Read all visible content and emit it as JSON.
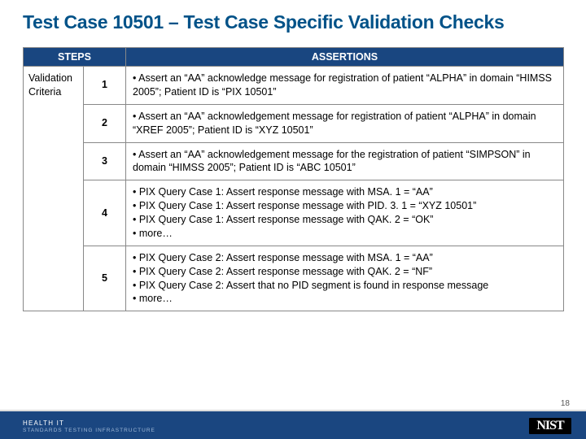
{
  "title": "Test Case 10501 – Test Case Specific Validation Checks",
  "table": {
    "headers": {
      "steps": "STEPS",
      "assertions": "ASSERTIONS"
    },
    "row_label": "Validation Criteria",
    "rows": [
      {
        "step": "1",
        "assertion": "• Assert an “AA” acknowledge message for registration of patient “ALPHA” in domain “HIMSS 2005”; Patient ID is “PIX 10501”"
      },
      {
        "step": "2",
        "assertion": "• Assert an “AA” acknowledgement message for registration of patient “ALPHA” in domain “XREF 2005”; Patient ID is “XYZ 10501”"
      },
      {
        "step": "3",
        "assertion": "• Assert an “AA” acknowledgement message for the registration of patient “SIMPSON” in domain “HIMSS 2005”; Patient ID is “ABC 10501”"
      },
      {
        "step": "4",
        "assertion": "• PIX Query Case 1: Assert response message with MSA. 1 = “AA”\n• PIX Query Case 1: Assert response message with PID. 3. 1 = “XYZ 10501”\n• PIX Query Case 1: Assert response message with QAK. 2 = “OK”\n• more…"
      },
      {
        "step": "5",
        "assertion": "• PIX Query Case 2: Assert response message with MSA. 1 = “AA”\n• PIX Query Case 2: Assert response message with QAK. 2 = “NF”\n• PIX Query Case 2: Assert that no PID segment is found in response message\n• more…"
      }
    ]
  },
  "footer": {
    "brand_top": "HEALTH IT",
    "brand_bottom": "STANDARDS TESTING INFRASTRUCTURE",
    "nist": "NIST"
  },
  "page_number": "18"
}
